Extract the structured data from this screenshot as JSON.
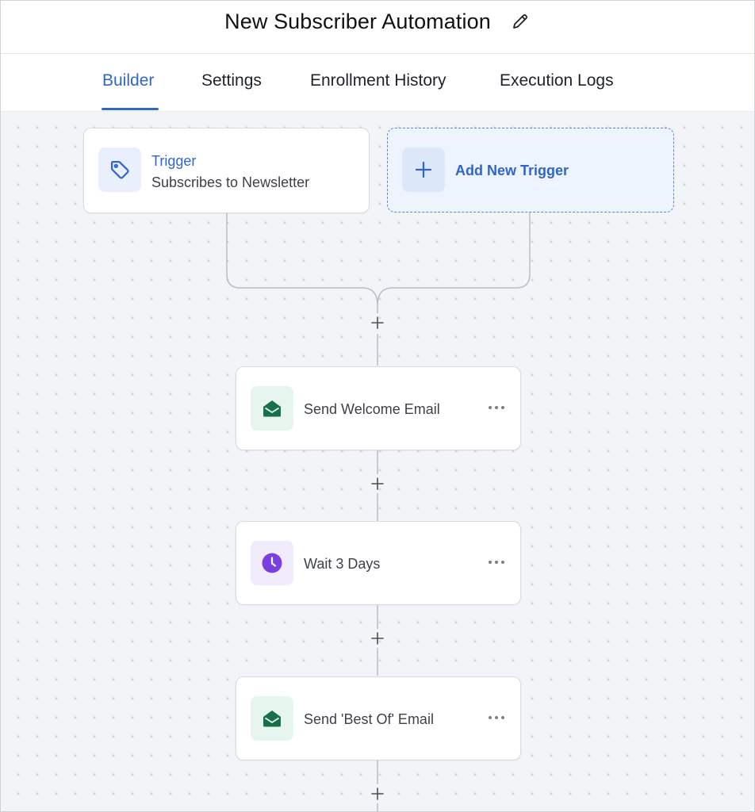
{
  "header": {
    "title": "New Subscriber Automation"
  },
  "tabs": [
    {
      "label": "Builder",
      "active": true
    },
    {
      "label": "Settings",
      "active": false
    },
    {
      "label": "Enrollment History",
      "active": false
    },
    {
      "label": "Execution Logs",
      "active": false
    }
  ],
  "trigger": {
    "title": "Trigger",
    "subtitle": "Subscribes to Newsletter",
    "icon": "tag-icon"
  },
  "add_trigger": {
    "label": "Add New Trigger",
    "icon": "plus-icon"
  },
  "steps": [
    {
      "label": "Send Welcome Email",
      "icon": "envelope-open-icon"
    },
    {
      "label": "Wait 3 Days",
      "icon": "clock-icon"
    },
    {
      "label": "Send 'Best Of' Email",
      "icon": "envelope-open-icon"
    }
  ],
  "colors": {
    "accent": "#2f66c9",
    "email_icon": "#17704a",
    "wait_icon": "#7b3fe0",
    "canvas": "#f3f4f7"
  }
}
